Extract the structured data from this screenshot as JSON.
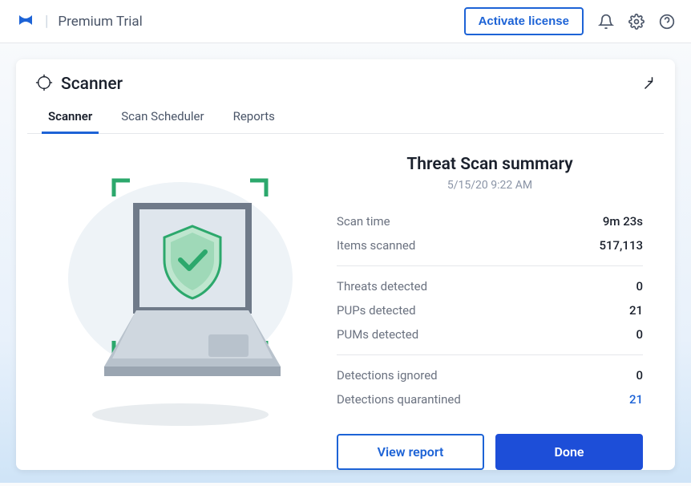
{
  "header": {
    "product_name": "Premium Trial",
    "activate_label": "Activate license"
  },
  "card": {
    "title": "Scanner",
    "tabs": [
      {
        "label": "Scanner"
      },
      {
        "label": "Scan Scheduler"
      },
      {
        "label": "Reports"
      }
    ]
  },
  "summary": {
    "title": "Threat Scan summary",
    "timestamp": "5/15/20 9:22 AM",
    "rows_group1": [
      {
        "label": "Scan time",
        "value": "9m 23s"
      },
      {
        "label": "Items scanned",
        "value": "517,113"
      }
    ],
    "rows_group2": [
      {
        "label": "Threats detected",
        "value": "0"
      },
      {
        "label": "PUPs detected",
        "value": "21"
      },
      {
        "label": "PUMs detected",
        "value": "0"
      }
    ],
    "rows_group3": [
      {
        "label": "Detections ignored",
        "value": "0"
      },
      {
        "label": "Detections quarantined",
        "value": "21",
        "link": true
      }
    ],
    "view_report_label": "View report",
    "done_label": "Done"
  }
}
